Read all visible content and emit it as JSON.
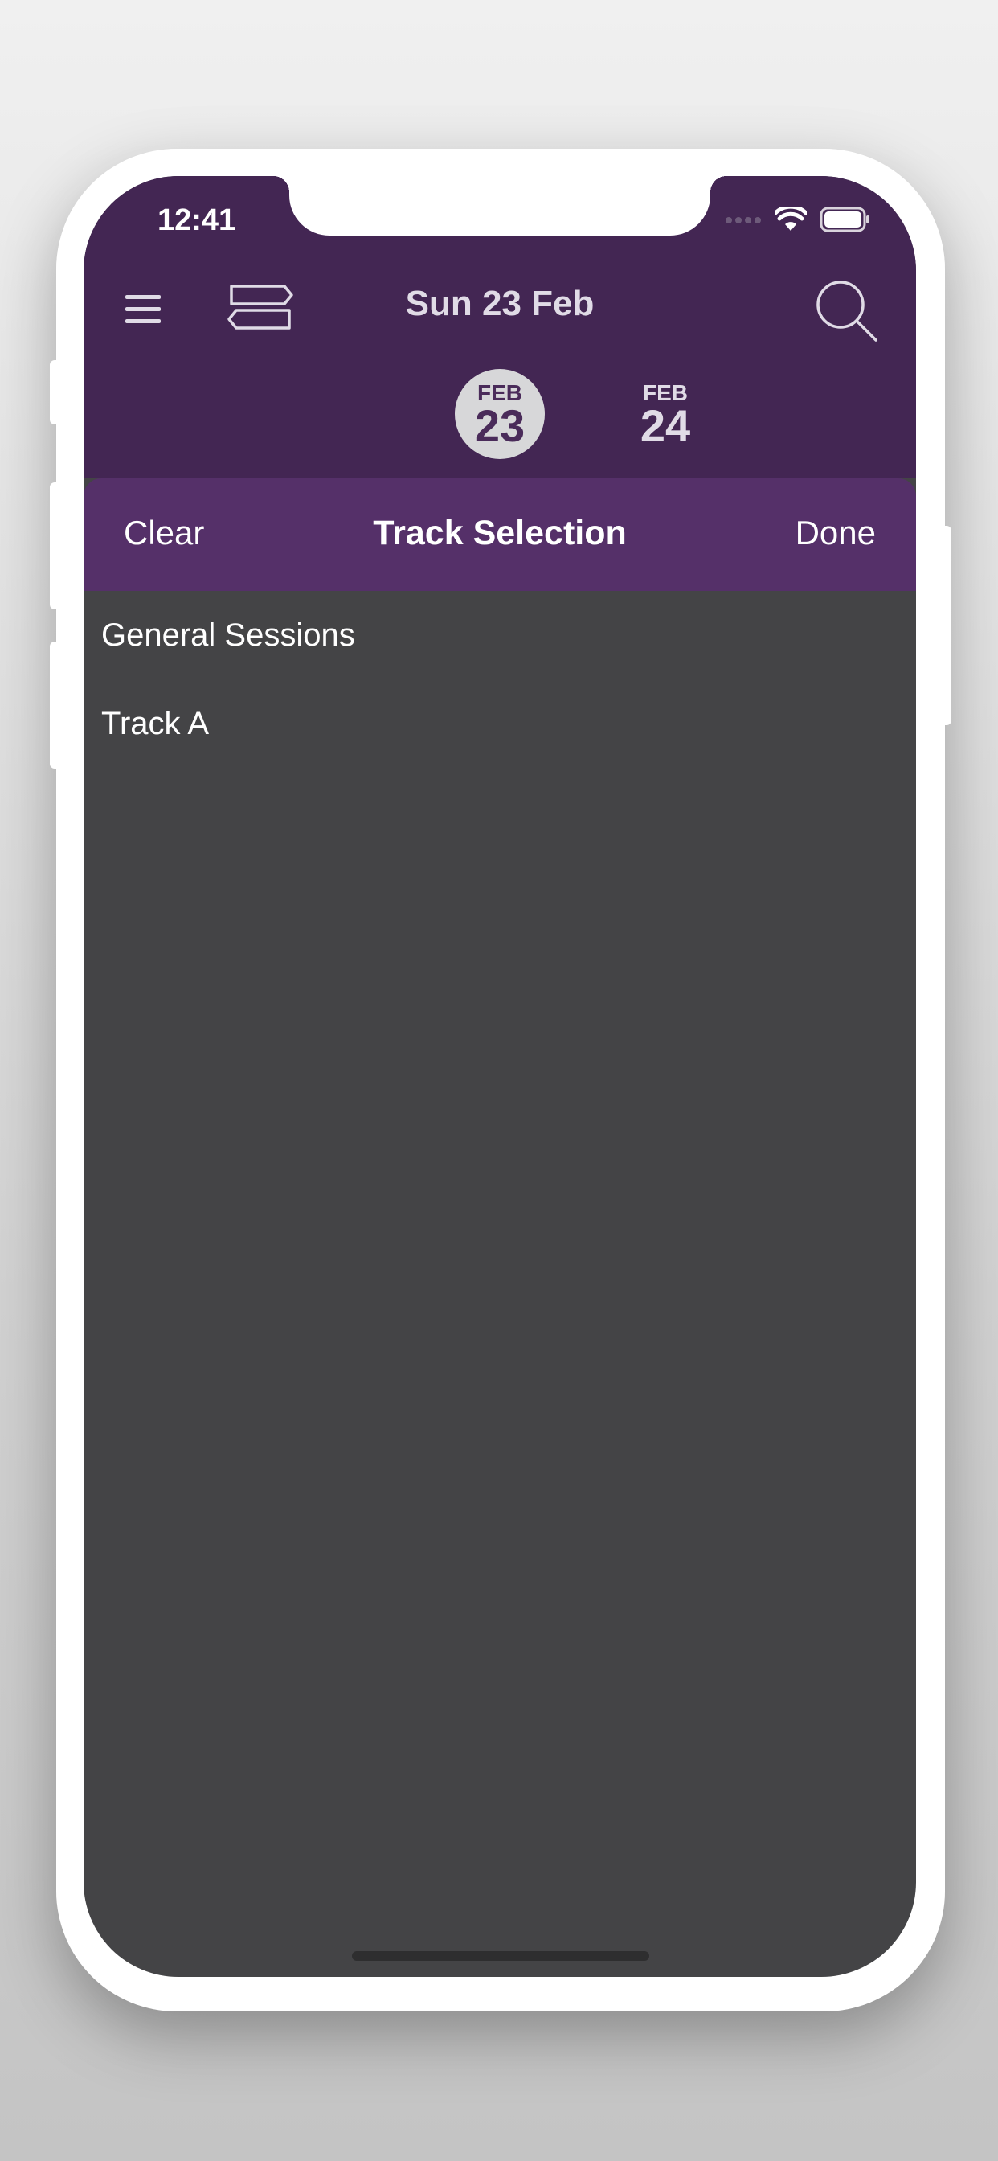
{
  "status_bar": {
    "time": "12:41"
  },
  "header": {
    "title": "Sun 23 Feb",
    "menu_icon": "hamburger-icon",
    "tracks_icon": "signpost-icon",
    "search_icon": "search-icon",
    "dates": [
      {
        "month": "FEB",
        "day": "23",
        "selected": true
      },
      {
        "month": "FEB",
        "day": "24",
        "selected": false
      }
    ]
  },
  "sheet": {
    "clear_label": "Clear",
    "title": "Track Selection",
    "done_label": "Done"
  },
  "tracks": [
    {
      "label": "General Sessions"
    },
    {
      "label": "Track A"
    }
  ],
  "colors": {
    "header_bg": "#432653",
    "sheet_bar_bg": "#553069",
    "list_bg": "#444446",
    "selected_date_bg": "#d7d7d9"
  }
}
